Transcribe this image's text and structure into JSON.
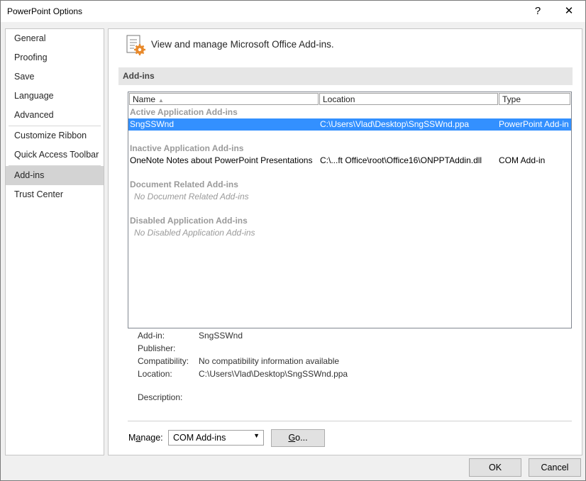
{
  "window": {
    "title": "PowerPoint Options",
    "help": "?",
    "close": "✕"
  },
  "nav": {
    "items": [
      {
        "label": "General"
      },
      {
        "label": "Proofing"
      },
      {
        "label": "Save"
      },
      {
        "label": "Language"
      },
      {
        "label": "Advanced"
      },
      {
        "label": "Customize Ribbon"
      },
      {
        "label": "Quick Access Toolbar"
      },
      {
        "label": "Add-ins",
        "selected": true
      },
      {
        "label": "Trust Center"
      }
    ]
  },
  "header": {
    "text": "View and manage Microsoft Office Add-ins."
  },
  "section": {
    "title": "Add-ins"
  },
  "table": {
    "columns": [
      "Name",
      "Location",
      "Type"
    ],
    "groups": {
      "active": {
        "label": "Active Application Add-ins",
        "rows": [
          {
            "name": "SngSSWnd",
            "location": "C:\\Users\\Vlad\\Desktop\\SngSSWnd.ppa",
            "type": "PowerPoint Add-in",
            "selected": true
          }
        ]
      },
      "inactive": {
        "label": "Inactive Application Add-ins",
        "rows": [
          {
            "name": "OneNote Notes about PowerPoint Presentations",
            "location": "C:\\...ft Office\\root\\Office16\\ONPPTAddin.dll",
            "type": "COM Add-in"
          }
        ]
      },
      "document": {
        "label": "Document Related Add-ins",
        "empty": "No Document Related Add-ins"
      },
      "disabled": {
        "label": "Disabled Application Add-ins",
        "empty": "No Disabled Application Add-ins"
      }
    }
  },
  "details": {
    "addin_label": "Add-in:",
    "addin_value": "SngSSWnd",
    "publisher_label": "Publisher:",
    "publisher_value": "",
    "compat_label": "Compatibility:",
    "compat_value": "No compatibility information available",
    "location_label": "Location:",
    "location_value": "C:\\Users\\Vlad\\Desktop\\SngSSWnd.ppa",
    "description_label": "Description:",
    "description_value": ""
  },
  "manage": {
    "label_prefix": "M",
    "label_underlined": "a",
    "label_suffix": "nage:",
    "selected": "COM Add-ins",
    "go_underlined": "G",
    "go_suffix": "o..."
  },
  "footer": {
    "ok": "OK",
    "cancel": "Cancel"
  },
  "colors": {
    "selection": "#3390ff",
    "nav_selected": "#d3d3d3",
    "gear_accent": "#e8892b"
  }
}
